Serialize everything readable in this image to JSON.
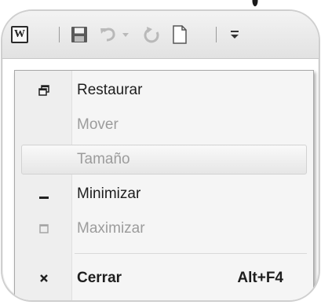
{
  "toolbar": {
    "app_icon_letter": "W"
  },
  "menu": {
    "items": [
      {
        "label": "Restaurar",
        "enabled": true,
        "icon": "restore-icon"
      },
      {
        "label": "Mover",
        "enabled": false,
        "icon": ""
      },
      {
        "label": "Tamaño",
        "enabled": false,
        "icon": "",
        "highlighted": true
      },
      {
        "label": "Minimizar",
        "enabled": true,
        "icon": "minimize-icon"
      },
      {
        "label": "Maximizar",
        "enabled": false,
        "icon": "maximize-icon"
      },
      {
        "label": "Cerrar",
        "enabled": true,
        "icon": "close-icon",
        "shortcut": "Alt+F4",
        "bold": true
      }
    ]
  },
  "colors": {
    "menu_background": "#f5f5f5",
    "disabled_text": "#9c9c9c",
    "text": "#1e1e1e"
  }
}
